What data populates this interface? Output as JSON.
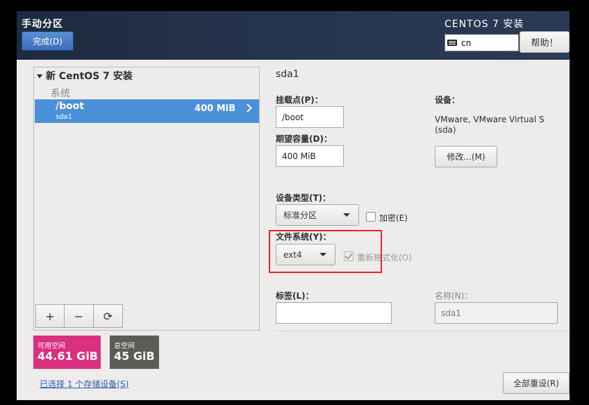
{
  "header": {
    "title": "手动分区",
    "done_label": "完成(D)",
    "product": "CENTOS 7 安装",
    "keyboard_layout": "cn",
    "help_label": "帮助！"
  },
  "tree": {
    "group_title": "新 CentOS 7 安装",
    "section_label": "系统",
    "partition": {
      "mount": "/boot",
      "device": "sda1",
      "size": "400 MiB"
    }
  },
  "toolbar": {
    "add": "+",
    "remove": "−",
    "refresh": "⟳"
  },
  "space": {
    "available_label": "可用空间",
    "available_value": "44.61 GiB",
    "total_label": "总空间",
    "total_value": "45 GiB"
  },
  "selected_devices_link": "已选择 1 个存储设备(S)",
  "details": {
    "title": "sda1",
    "mount_label": "挂载点(P)：",
    "mount_value": "/boot",
    "capacity_label": "期望容量(D)：",
    "capacity_value": "400 MiB",
    "device_label": "设备：",
    "device_value_line1": "VMware, VMware Virtual S",
    "device_value_line2": "(sda)",
    "modify_label": "修改...(M)",
    "device_type_label": "设备类型(T)：",
    "device_type_value": "标准分区",
    "encrypt_label": "加密(E)",
    "fs_label": "文件系统(Y)：",
    "fs_value": "ext4",
    "reformat_label": "重新格式化(O)",
    "tag_label": "标签(L)：",
    "tag_value": "",
    "name_label": "名称(N)：",
    "name_value": "sda1",
    "reset_all_label": "全部重设(R)"
  },
  "colors": {
    "accent": "#4a90d9",
    "available_tile": "#d9307f",
    "total_tile": "#5b5b58",
    "highlight": "#e2252b"
  }
}
